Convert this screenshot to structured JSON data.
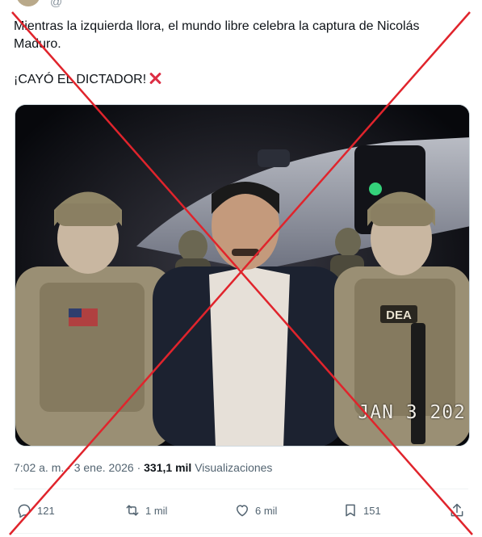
{
  "tweet": {
    "text": "Mientras la izquierda llora, el mundo libre celebra la captura de Nicolás Maduro.",
    "headline": "¡CAYÓ EL DICTADOR!",
    "headline_emoji": "cross-mark-icon"
  },
  "photo": {
    "datestamp": "JAN 3 202"
  },
  "meta": {
    "time": "7:02 a. m.",
    "separator": "·",
    "date": "3 ene. 2026",
    "separator2": "·",
    "views_count": "331,1 mil",
    "views_label": "Visualizaciones"
  },
  "actions": {
    "replies": "121",
    "reposts": "1 mil",
    "likes": "6 mil",
    "bookmarks": "151"
  },
  "colors": {
    "overlay_x": "#e0242c",
    "muted_text": "#536471",
    "emoji_red": "#dd2e44"
  }
}
